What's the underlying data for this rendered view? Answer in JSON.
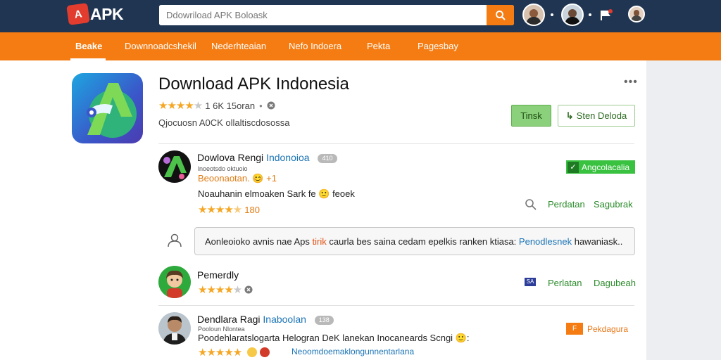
{
  "header": {
    "logo_text": "APK",
    "logo_mark": "A",
    "search_placeholder": "Ddowriload APK Boloask",
    "search_icon": "search-icon",
    "flag_badge": "5"
  },
  "nav": {
    "items": [
      {
        "label": "Beake",
        "active": true
      },
      {
        "label": "Downnoadcshekil",
        "active": false
      },
      {
        "label": "Nederhteaian",
        "active": false
      },
      {
        "label": "Nefo Indoera",
        "active": false
      },
      {
        "label": "Pekta",
        "active": false
      },
      {
        "label": "Pagesbay",
        "active": false
      }
    ]
  },
  "app": {
    "title": "Download APK Indonesia",
    "rating_text": "1 6K 15oran",
    "stars": 4,
    "subtitle": "Qjocuosn A0CK ollaltiscdosossa",
    "install_label": "Tinsk",
    "detail_label": "Sten Deloda",
    "more_label": "•••"
  },
  "rows": [
    {
      "title_a": "Dowlova Rengi",
      "title_b": "Indonoioa",
      "pill": "410",
      "sub": "lnoeotsdo oktuoio",
      "meta": "Beoonaotan. 😊 +1",
      "text": "Noauhanin elmoaken Sark fe 🙂 feoek",
      "rating_value": "180",
      "stars": 4,
      "tag": "Angcolacalia",
      "action_1": "Perdatan",
      "action_2": "Sagubrak"
    },
    {
      "comment_pre": "Aonleoioko avnis nae Aps",
      "comment_hl": "tirik",
      "comment_mid": "caurla bes saina cedam epelkis ranken ktiasa:",
      "comment_link": "Penodlesnek",
      "comment_post": "hawaniask.."
    },
    {
      "title_a": "Pemerdly",
      "stars": 4,
      "action_1": "Perlatan",
      "action_2": "Dagubeah",
      "flag_code": "SA"
    },
    {
      "title_a": "Dendlara Ragi",
      "title_b": "Inaboolan",
      "pill": "138",
      "sub": "Pooloun Nlontea",
      "text": "Poodehlaratslogarta Helogran DeK lanekan Inocaneards Scngi 🙂:",
      "link": "Neoomdoemaklongunnentarlana",
      "stars": 5,
      "tag": "Pekdagura",
      "tag_box": "F"
    }
  ],
  "colors": {
    "topbar": "#1f3552",
    "nav": "#f57c12",
    "green": "#39c140",
    "link": "#1a73b5"
  }
}
